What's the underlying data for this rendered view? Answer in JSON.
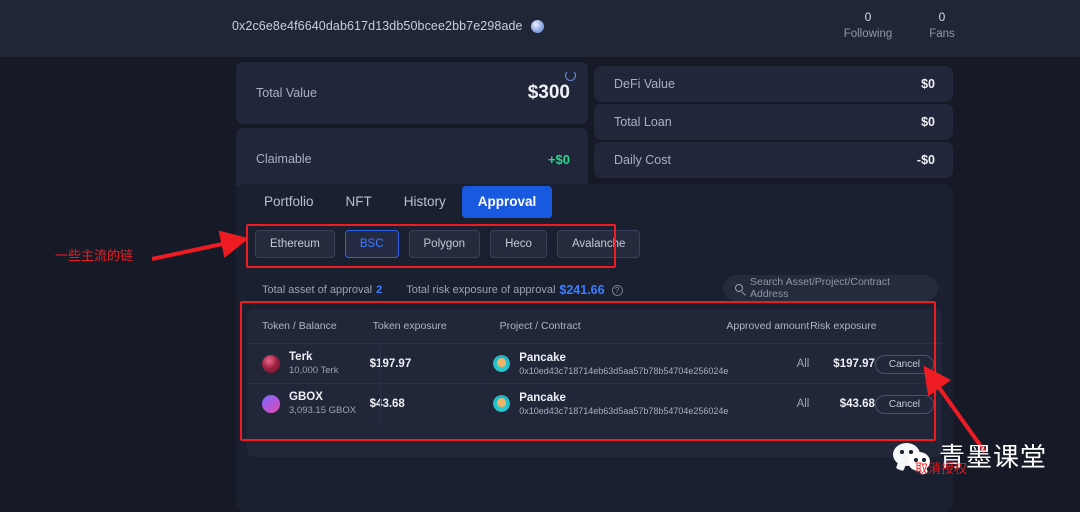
{
  "header": {
    "wallet_address": "0x2c6e8e4f6640dab617d13db50bcee2bb7e298ade",
    "copy_icon": "copy-icon",
    "following_count": "0",
    "following_label": "Following",
    "fans_count": "0",
    "fans_label": "Fans"
  },
  "summary": {
    "total_value_label": "Total Value",
    "total_value": "$300",
    "refresh_icon": "refresh-icon",
    "claimable_label": "Claimable",
    "claimable_value": "+$0",
    "defi_label": "DeFi Value",
    "defi_value": "$0",
    "loan_label": "Total Loan",
    "loan_value": "$0",
    "daily_label": "Daily Cost",
    "daily_value": "-$0"
  },
  "tabs": [
    {
      "label": "Portfolio",
      "active": false
    },
    {
      "label": "NFT",
      "active": false
    },
    {
      "label": "History",
      "active": false
    },
    {
      "label": "Approval",
      "active": true
    }
  ],
  "chains": [
    {
      "label": "Ethereum",
      "selected": false
    },
    {
      "label": "BSC",
      "selected": true
    },
    {
      "label": "Polygon",
      "selected": false
    },
    {
      "label": "Heco",
      "selected": false
    },
    {
      "label": "Avalanche",
      "selected": false
    }
  ],
  "stats": {
    "asset_label": "Total asset of approval",
    "asset_value": "2",
    "risk_label": "Total risk exposure of approval",
    "risk_value": "$241.66",
    "help_icon": "question-mark-icon"
  },
  "search": {
    "icon": "search-icon",
    "placeholder": "Search Asset/Project/Contract Address",
    "value": ""
  },
  "table": {
    "columns": {
      "token": "Token / Balance",
      "exposure": "Token exposure",
      "project": "Project / Contract",
      "approved": "Approved amount",
      "risk": "Risk exposure"
    },
    "rows": [
      {
        "token_icon": "terk-token-icon",
        "token_name": "Terk",
        "token_balance": "10,000 Terk",
        "token_exposure": "$197.97",
        "project_icon": "pancakeswap-icon",
        "project_name": "Pancake",
        "contract_address": "0x10ed43c718714eb63d5aa57b78b54704e256024e",
        "approved_amount": "All",
        "risk_exposure": "$197.97",
        "action_label": "Cancel"
      },
      {
        "token_icon": "gbox-token-icon",
        "token_name": "GBOX",
        "token_balance": "3,093.15 GBOX",
        "token_exposure": "$43.68",
        "project_icon": "pancakeswap-icon",
        "project_name": "Pancake",
        "contract_address": "0x10ed43c718714eb63d5aa57b78b54704e256024e",
        "approved_amount": "All",
        "risk_exposure": "$43.68",
        "action_label": "Cancel"
      }
    ]
  },
  "annotations": {
    "chain_note": "一些主流的链",
    "watermark_text": "青墨课堂",
    "watermark_icon": "wechat-icon",
    "watermark_overlay": "取消授权",
    "box_color": "#ee1b23"
  }
}
